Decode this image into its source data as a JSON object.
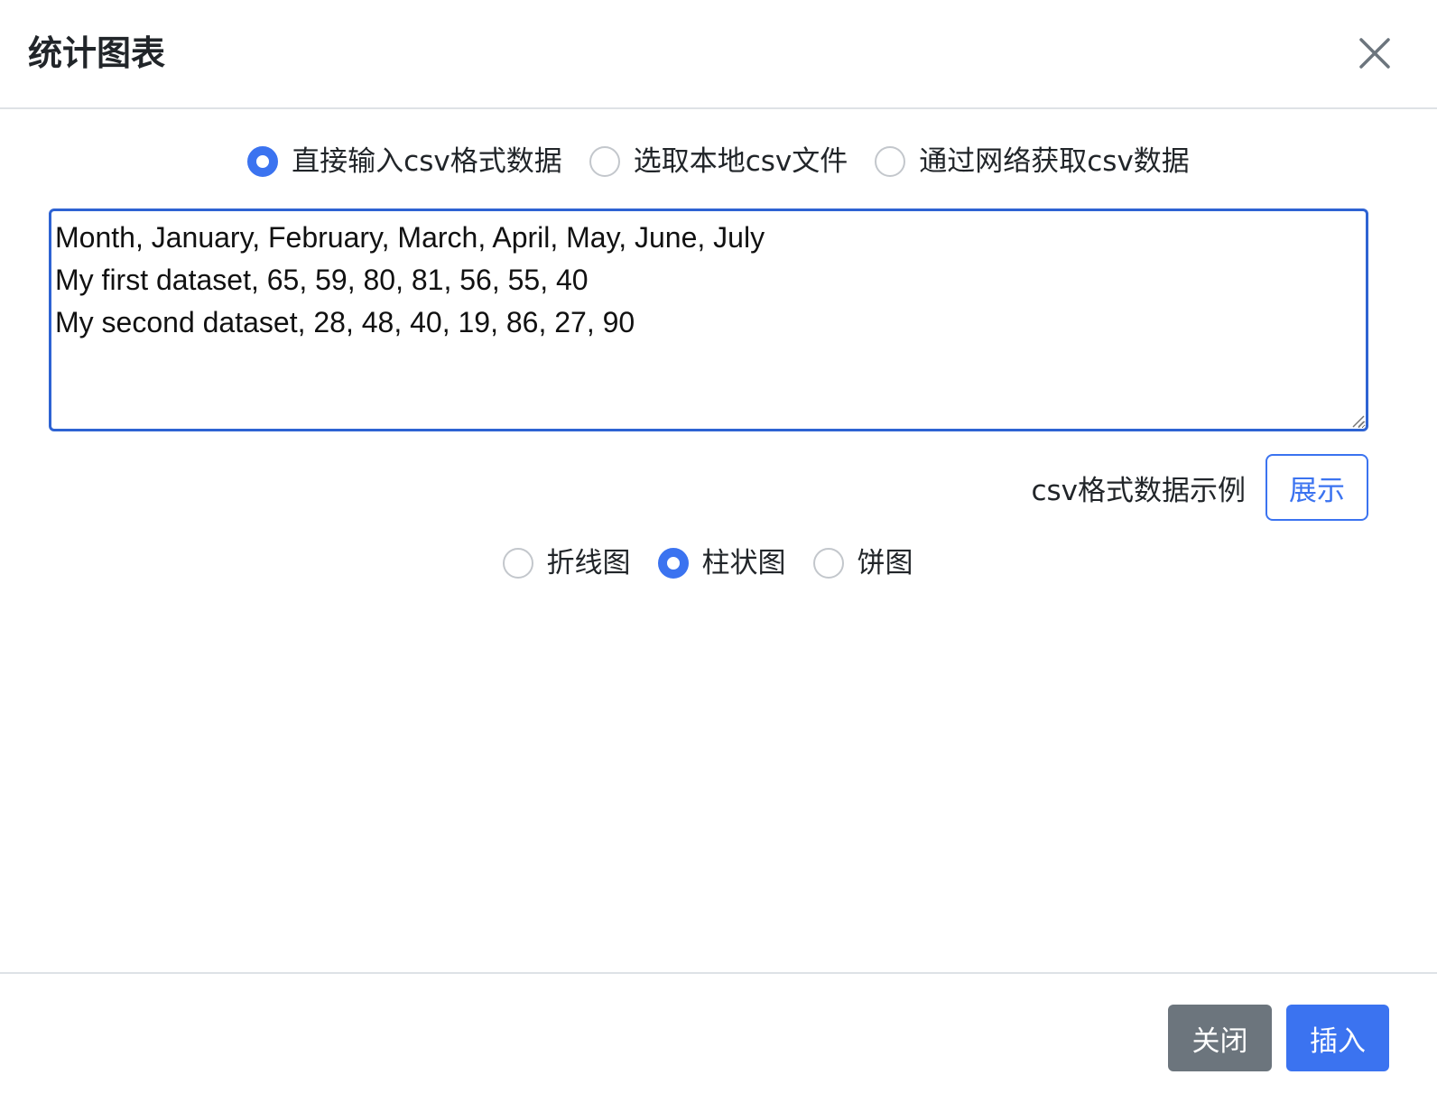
{
  "header": {
    "title": "统计图表"
  },
  "source_options": [
    {
      "label": "直接输入csv格式数据",
      "checked": true
    },
    {
      "label": "选取本地csv文件",
      "checked": false
    },
    {
      "label": "通过网络获取csv数据",
      "checked": false
    }
  ],
  "csv_input": {
    "value": "Month, January, February, March, April, May, June, July\nMy first dataset, 65, 59, 80, 81, 56, 55, 40\nMy second dataset, 28, 48, 40, 19, 86, 27, 90"
  },
  "example": {
    "label": "csv格式数据示例",
    "button_label": "展示"
  },
  "chart_types": [
    {
      "label": "折线图",
      "checked": false
    },
    {
      "label": "柱状图",
      "checked": true
    },
    {
      "label": "饼图",
      "checked": false
    }
  ],
  "footer": {
    "close_label": "关闭",
    "insert_label": "插入"
  },
  "colors": {
    "primary": "#3b73f0",
    "secondary": "#6c757d",
    "textarea_focus_border": "#2e63d3"
  },
  "icons": {
    "close": "close-icon",
    "resize": "resize-grip-icon"
  }
}
